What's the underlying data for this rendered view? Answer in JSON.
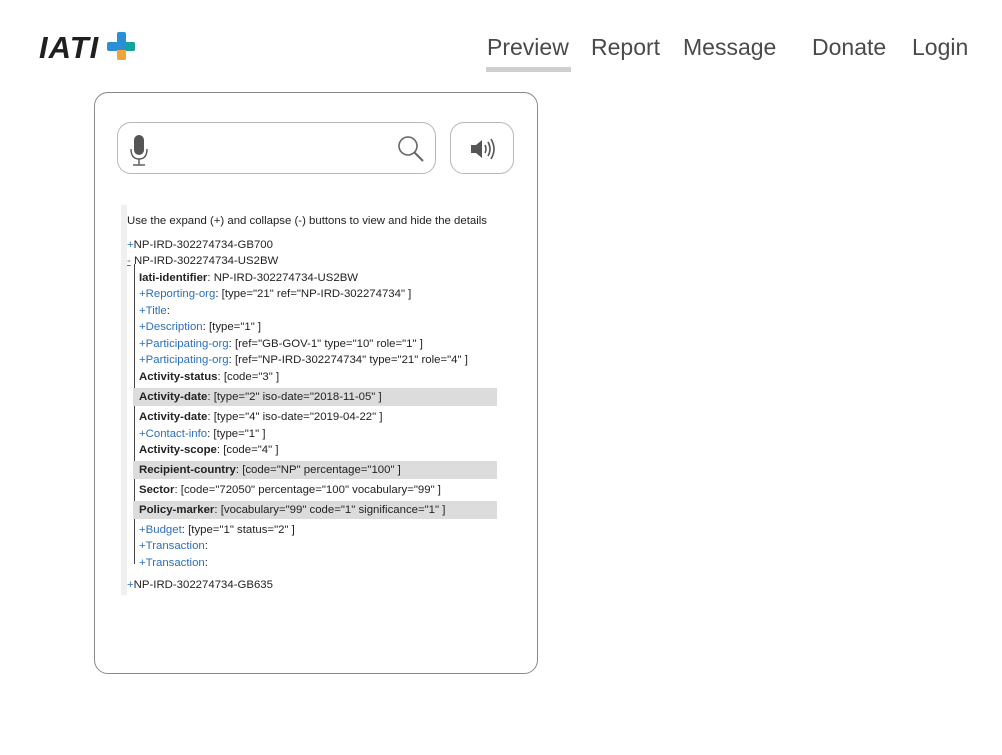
{
  "header": {
    "logo_text": "IATI",
    "nav": [
      {
        "label": "Preview"
      },
      {
        "label": "Report"
      },
      {
        "label": "Message"
      },
      {
        "label": "Donate"
      },
      {
        "label": "Login"
      }
    ],
    "active_nav": "Preview"
  },
  "search": {
    "value": "",
    "mic_icon": "microphone-icon",
    "search_icon": "magnifier-icon",
    "speaker_icon": "speaker-icon"
  },
  "tree": {
    "hint": "Use the expand (+) and collapse (-) buttons to view and hide the details",
    "activity1": {
      "toggle": "+",
      "id": "NP-IRD-302274734-GB700"
    },
    "activity2": {
      "toggle": "-",
      "id": "NP-IRD-302274734-US2BW"
    },
    "activity3": {
      "toggle": "+",
      "id": "NP-IRD-302274734-GB635"
    },
    "children": [
      {
        "toggle": "",
        "label": "Iati-identifier",
        "sep": ":  ",
        "value": "NP-IRD-302274734-US2BW"
      },
      {
        "toggle": "+",
        "label": "Reporting-org",
        "sep": ": ",
        "value": "[type=\"21\" ref=\"NP-IRD-302274734\" ]"
      },
      {
        "toggle": "+",
        "label": "Title",
        "sep": ":",
        "value": ""
      },
      {
        "toggle": "+",
        "label": "Description",
        "sep": ": ",
        "value": "[type=\"1\" ]"
      },
      {
        "toggle": "+",
        "label": "Participating-org",
        "sep": ": ",
        "value": "[ref=\"GB-GOV-1\" type=\"10\" role=\"1\" ]"
      },
      {
        "toggle": "+",
        "label": "Participating-org",
        "sep": ": ",
        "value": "[ref=\"NP-IRD-302274734\" type=\"21\" role=\"4\" ]"
      },
      {
        "toggle": "",
        "label": "Activity-status",
        "sep": ": ",
        "value": "[code=\"3\" ]"
      },
      {
        "toggle": "",
        "label": "Activity-date",
        "sep": ": ",
        "value": "[type=\"2\" iso-date=\"2018-11-05\" ]"
      },
      {
        "toggle": "",
        "label": "Activity-date",
        "sep": ": ",
        "value": "[type=\"4\" iso-date=\"2019-04-22\" ]"
      },
      {
        "toggle": "+",
        "label": "Contact-info",
        "sep": ": ",
        "value": "[type=\"1\" ]"
      },
      {
        "toggle": "",
        "label": "Activity-scope",
        "sep": ": ",
        "value": "[code=\"4\" ]"
      },
      {
        "toggle": "",
        "label": "Recipient-country",
        "sep": ": ",
        "value": "[code=\"NP\" percentage=\"100\" ]"
      },
      {
        "toggle": "",
        "label": "Sector",
        "sep": ": ",
        "value": "[code=\"72050\" percentage=\"100\" vocabulary=\"99\" ]"
      },
      {
        "toggle": "",
        "label": "Policy-marker",
        "sep": ": ",
        "value": "[vocabulary=\"99\" code=\"1\" significance=\"1\" ]"
      },
      {
        "toggle": "+",
        "label": "Budget",
        "sep": ": ",
        "value": "[type=\"1\" status=\"2\" ]"
      },
      {
        "toggle": "+",
        "label": "Transaction",
        "sep": ":",
        "value": ""
      },
      {
        "toggle": "+",
        "label": "Transaction",
        "sep": ":",
        "value": ""
      }
    ]
  },
  "colors": {
    "link": "#2c6fb5",
    "shade": "#dcdcdc",
    "logo_blue": "#2b8fd6"
  }
}
